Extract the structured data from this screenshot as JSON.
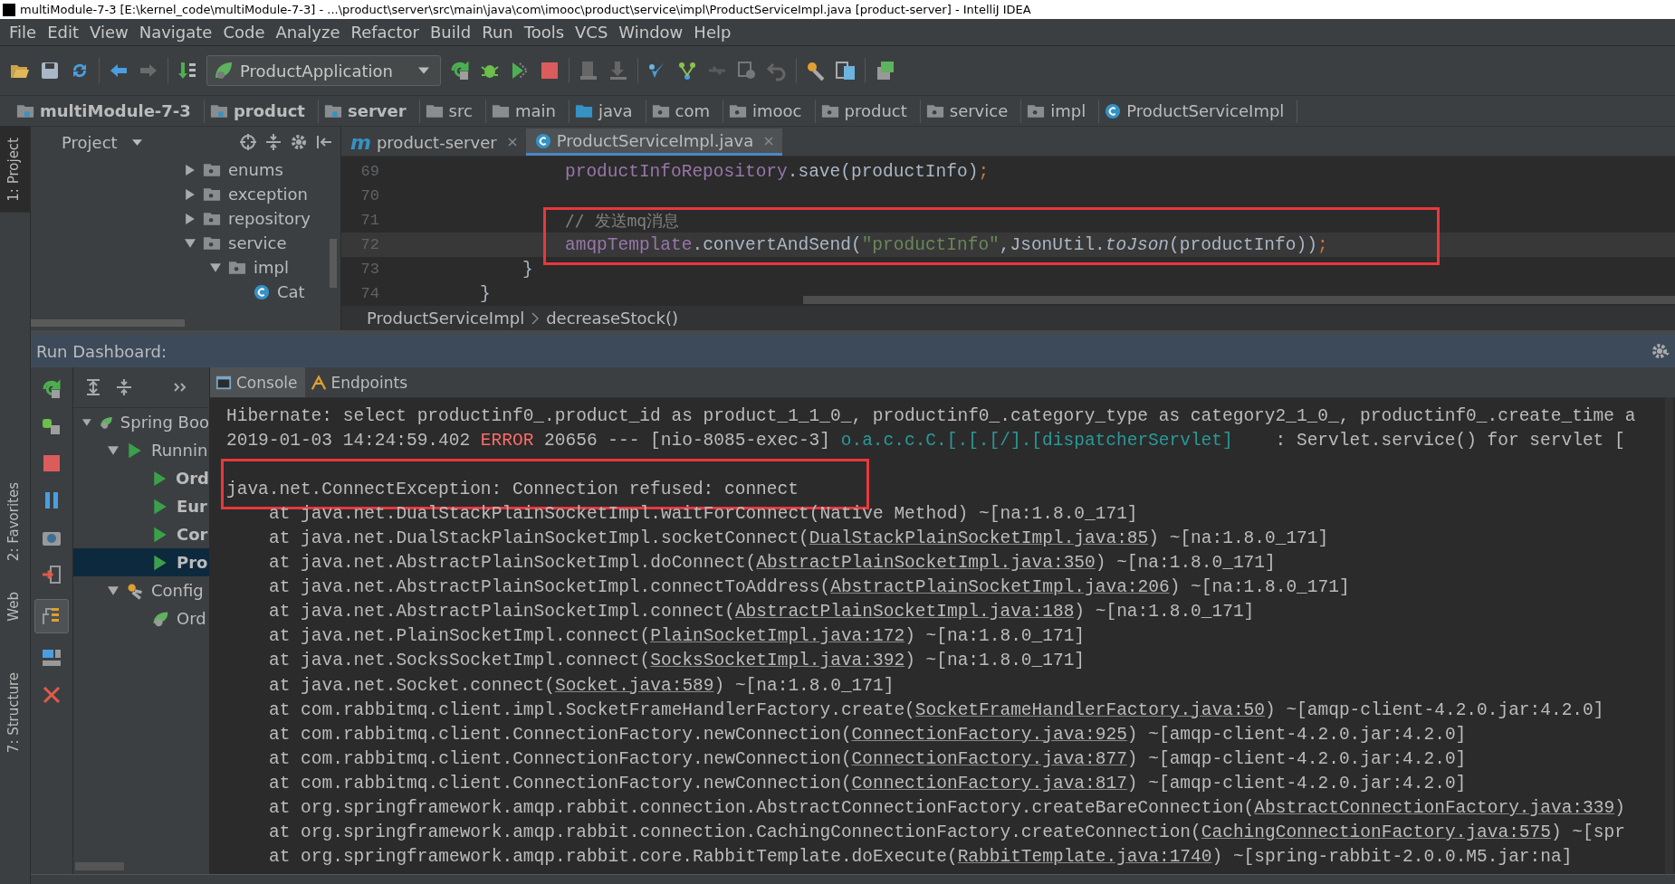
{
  "window": {
    "title": "multiModule-7-3 [E:\\kernel_code\\multiModule-7-3] - ...\\product\\server\\src\\main\\java\\com\\imooc\\product\\service\\impl\\ProductServiceImpl.java [product-server] - IntelliJ IDEA"
  },
  "menu": [
    "File",
    "Edit",
    "View",
    "Navigate",
    "Code",
    "Analyze",
    "Refactor",
    "Build",
    "Run",
    "Tools",
    "VCS",
    "Window",
    "Help"
  ],
  "toolbar": {
    "run_configuration": "ProductApplication"
  },
  "breadcrumbs": [
    {
      "label": "multiModule-7-3",
      "kind": "module"
    },
    {
      "label": "product",
      "kind": "module"
    },
    {
      "label": "server",
      "kind": "module"
    },
    {
      "label": "src",
      "kind": "folder"
    },
    {
      "label": "main",
      "kind": "folder"
    },
    {
      "label": "java",
      "kind": "source"
    },
    {
      "label": "com",
      "kind": "package"
    },
    {
      "label": "imooc",
      "kind": "package"
    },
    {
      "label": "product",
      "kind": "package"
    },
    {
      "label": "service",
      "kind": "package"
    },
    {
      "label": "impl",
      "kind": "package"
    },
    {
      "label": "ProductServiceImpl",
      "kind": "class"
    }
  ],
  "tool_stripe": [
    {
      "label": "1: Project",
      "kind": "project",
      "selected": true
    },
    {
      "label": "2: Favorites",
      "kind": "favorites",
      "selected": false
    },
    {
      "label": "Web",
      "kind": "web",
      "selected": false
    },
    {
      "label": "7: Structure",
      "kind": "structure",
      "selected": false
    }
  ],
  "project_panel": {
    "title": "Project",
    "tree": [
      {
        "label": "enums",
        "kind": "package",
        "expanded": false
      },
      {
        "label": "exception",
        "kind": "package",
        "expanded": false
      },
      {
        "label": "repository",
        "kind": "package",
        "expanded": false
      },
      {
        "label": "service",
        "kind": "package",
        "expanded": true,
        "children": [
          {
            "label": "impl",
            "kind": "package",
            "expanded": true,
            "children": [
              {
                "label": "Cat",
                "kind": "class"
              }
            ]
          }
        ]
      }
    ]
  },
  "editor": {
    "tabs": [
      {
        "label": "product-server",
        "kind": "maven",
        "icon_text": "m",
        "selected": false
      },
      {
        "label": "ProductServiceImpl.java",
        "kind": "class",
        "selected": true
      }
    ],
    "lines": [
      {
        "number": "69",
        "kind": "statement",
        "boxed": false,
        "current": false,
        "segments": [
          {
            "text": "productInfoRepository",
            "kind": "field"
          },
          {
            "text": ".save(productInfo)",
            "kind": "plain"
          },
          {
            "text": ";",
            "kind": "punct"
          }
        ]
      },
      {
        "number": "70",
        "boxed": false,
        "current": false
      },
      {
        "number": "71",
        "kind": "statement",
        "boxed": true,
        "current": false,
        "segments": [
          {
            "text": "// 发送mq消息",
            "kind": "comment"
          }
        ]
      },
      {
        "number": "72",
        "kind": "statement",
        "boxed": true,
        "current": true,
        "segments": [
          {
            "text": "amqpTemplate",
            "kind": "field"
          },
          {
            "text": ".convertAndSend(",
            "kind": "plain"
          },
          {
            "text": "\"productInfo\"",
            "kind": "string"
          },
          {
            "text": ",JsonUtil.",
            "kind": "plain"
          },
          {
            "text": "toJson",
            "kind": "static"
          },
          {
            "text": "(productInfo))",
            "kind": "plain"
          },
          {
            "text": ";",
            "kind": "punct"
          }
        ]
      },
      {
        "number": "73",
        "kind": "method-end",
        "boxed": false,
        "current": false,
        "segments": [
          {
            "text": "}",
            "kind": "plain"
          }
        ]
      },
      {
        "number": "74",
        "kind": "class-end",
        "boxed": false,
        "current": false,
        "segments": [
          {
            "text": "}",
            "kind": "plain"
          }
        ]
      }
    ],
    "breadcrumb": [
      "ProductServiceImpl",
      "decreaseStock()"
    ]
  },
  "run_dashboard": {
    "title": "Run Dashboard:",
    "tree": [
      {
        "label": "Spring Boo",
        "kind": "spring",
        "expanded": true,
        "selected": false,
        "children": [
          {
            "label": "Runnin",
            "kind": "running",
            "expanded": true,
            "selected": false,
            "children": [
              {
                "label": "Ord",
                "kind": "app",
                "selected": false
              },
              {
                "label": "Eur",
                "kind": "app",
                "selected": false
              },
              {
                "label": "Cor",
                "kind": "app",
                "selected": false
              },
              {
                "label": "Pro",
                "kind": "app",
                "selected": true
              }
            ]
          },
          {
            "label": "Config",
            "kind": "config",
            "expanded": true,
            "selected": false,
            "children": [
              {
                "label": "Ord",
                "kind": "spring-app",
                "selected": false
              }
            ]
          }
        ]
      }
    ],
    "console_tabs": [
      {
        "label": "Console",
        "kind": "console",
        "selected": true
      },
      {
        "label": "Endpoints",
        "kind": "endpoints",
        "selected": false
      }
    ],
    "console": [
      {
        "kind": "message",
        "boxed": false,
        "segments": [
          {
            "text": "Hibernate: select productinf0_.product_id as product_1_1_0_, productinf0_.category_type as category2_1_0_, productinf0_.create_time a",
            "kind": "text"
          }
        ]
      },
      {
        "kind": "message",
        "boxed": false,
        "segments": [
          {
            "text": "2019-01-03 14:24:59.402 ",
            "kind": "text"
          },
          {
            "text": "ERROR",
            "kind": "error"
          },
          {
            "text": " 20656 --- [nio-8085-exec-3] ",
            "kind": "text"
          },
          {
            "text": "o.a.c.c.C.[.[.[/].[dispatcherServlet]",
            "kind": "logger"
          },
          {
            "text": "    : Servlet.service() for servlet [",
            "kind": "text"
          }
        ]
      },
      {
        "boxed": false
      },
      {
        "kind": "message",
        "boxed": true,
        "segments": [
          {
            "text": "java.net.ConnectException: Connection refused: connect",
            "kind": "text"
          }
        ]
      },
      {
        "kind": "frame",
        "boxed": false,
        "segments": [
          {
            "text": "at java.net.DualStackPlainSocketImpl.waitForConnect(Native Method) ~[na:1.8.0_171]",
            "kind": "text"
          }
        ]
      },
      {
        "kind": "frame",
        "boxed": false,
        "segments": [
          {
            "text": "at java.net.DualStackPlainSocketImpl.socketConnect(",
            "kind": "text"
          },
          {
            "text": "DualStackPlainSocketImpl.java:85",
            "kind": "link"
          },
          {
            "text": ") ~[na:1.8.0_171]",
            "kind": "text"
          }
        ]
      },
      {
        "kind": "frame",
        "boxed": false,
        "segments": [
          {
            "text": "at java.net.AbstractPlainSocketImpl.doConnect(",
            "kind": "text"
          },
          {
            "text": "AbstractPlainSocketImpl.java:350",
            "kind": "link"
          },
          {
            "text": ") ~[na:1.8.0_171]",
            "kind": "text"
          }
        ]
      },
      {
        "kind": "frame",
        "boxed": false,
        "segments": [
          {
            "text": "at java.net.AbstractPlainSocketImpl.connectToAddress(",
            "kind": "text"
          },
          {
            "text": "AbstractPlainSocketImpl.java:206",
            "kind": "link"
          },
          {
            "text": ") ~[na:1.8.0_171]",
            "kind": "text"
          }
        ]
      },
      {
        "kind": "frame",
        "boxed": false,
        "segments": [
          {
            "text": "at java.net.AbstractPlainSocketImpl.connect(",
            "kind": "text"
          },
          {
            "text": "AbstractPlainSocketImpl.java:188",
            "kind": "link"
          },
          {
            "text": ") ~[na:1.8.0_171]",
            "kind": "text"
          }
        ]
      },
      {
        "kind": "frame",
        "boxed": false,
        "segments": [
          {
            "text": "at java.net.PlainSocketImpl.connect(",
            "kind": "text"
          },
          {
            "text": "PlainSocketImpl.java:172",
            "kind": "link"
          },
          {
            "text": ") ~[na:1.8.0_171]",
            "kind": "text"
          }
        ]
      },
      {
        "kind": "frame",
        "boxed": false,
        "segments": [
          {
            "text": "at java.net.SocksSocketImpl.connect(",
            "kind": "text"
          },
          {
            "text": "SocksSocketImpl.java:392",
            "kind": "link"
          },
          {
            "text": ") ~[na:1.8.0_171]",
            "kind": "text"
          }
        ]
      },
      {
        "kind": "frame",
        "boxed": false,
        "segments": [
          {
            "text": "at java.net.Socket.connect(",
            "kind": "text"
          },
          {
            "text": "Socket.java:589",
            "kind": "link"
          },
          {
            "text": ") ~[na:1.8.0_171]",
            "kind": "text"
          }
        ]
      },
      {
        "kind": "frame",
        "boxed": false,
        "segments": [
          {
            "text": "at com.rabbitmq.client.impl.SocketFrameHandlerFactory.create(",
            "kind": "text"
          },
          {
            "text": "SocketFrameHandlerFactory.java:50",
            "kind": "link"
          },
          {
            "text": ") ~[amqp-client-4.2.0.jar:4.2.0]",
            "kind": "text"
          }
        ]
      },
      {
        "kind": "frame",
        "boxed": false,
        "segments": [
          {
            "text": "at com.rabbitmq.client.ConnectionFactory.newConnection(",
            "kind": "text"
          },
          {
            "text": "ConnectionFactory.java:925",
            "kind": "link"
          },
          {
            "text": ") ~[amqp-client-4.2.0.jar:4.2.0]",
            "kind": "text"
          }
        ]
      },
      {
        "kind": "frame",
        "boxed": false,
        "segments": [
          {
            "text": "at com.rabbitmq.client.ConnectionFactory.newConnection(",
            "kind": "text"
          },
          {
            "text": "ConnectionFactory.java:877",
            "kind": "link"
          },
          {
            "text": ") ~[amqp-client-4.2.0.jar:4.2.0]",
            "kind": "text"
          }
        ]
      },
      {
        "kind": "frame",
        "boxed": false,
        "segments": [
          {
            "text": "at com.rabbitmq.client.ConnectionFactory.newConnection(",
            "kind": "text"
          },
          {
            "text": "ConnectionFactory.java:817",
            "kind": "link"
          },
          {
            "text": ") ~[amqp-client-4.2.0.jar:4.2.0]",
            "kind": "text"
          }
        ]
      },
      {
        "kind": "frame",
        "boxed": false,
        "segments": [
          {
            "text": "at org.springframework.amqp.rabbit.connection.AbstractConnectionFactory.createBareConnection(",
            "kind": "text"
          },
          {
            "text": "AbstractConnectionFactory.java:339",
            "kind": "link"
          },
          {
            "text": ")",
            "kind": "text"
          }
        ]
      },
      {
        "kind": "frame",
        "boxed": false,
        "segments": [
          {
            "text": "at org.springframework.amqp.rabbit.connection.CachingConnectionFactory.createConnection(",
            "kind": "text"
          },
          {
            "text": "CachingConnectionFactory.java:575",
            "kind": "link"
          },
          {
            "text": ") ~[spr",
            "kind": "text"
          }
        ]
      },
      {
        "kind": "frame",
        "boxed": false,
        "segments": [
          {
            "text": "at org.springframework.amqp.rabbit.core.RabbitTemplate.doExecute(",
            "kind": "text"
          },
          {
            "text": "RabbitTemplate.java:1740",
            "kind": "link"
          },
          {
            "text": ") ~[spring-rabbit-2.0.0.M5.jar:na]",
            "kind": "text"
          }
        ]
      }
    ]
  }
}
